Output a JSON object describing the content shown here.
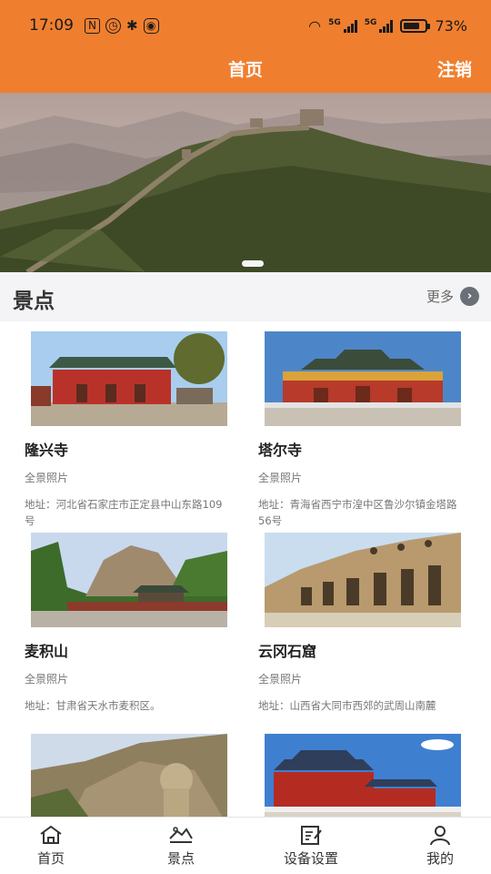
{
  "status_bar": {
    "time": "17:09",
    "battery": "73%",
    "network_1": "5G",
    "network_2": "5G",
    "icons": [
      "nfc-icon",
      "alarm-icon",
      "bluetooth-icon",
      "eye-icon",
      "wifi-icon",
      "signal-icon",
      "battery-icon"
    ]
  },
  "header": {
    "title": "首页",
    "logout": "注销"
  },
  "section": {
    "title": "景点",
    "more": "更多"
  },
  "attractions": [
    {
      "name": "隆兴寺",
      "tag": "全景照片",
      "address": "地址：河北省石家庄市正定县中山东路109号"
    },
    {
      "name": "塔尔寺",
      "tag": "全景照片",
      "address": "地址：青海省西宁市湟中区鲁沙尔镇金塔路56号"
    },
    {
      "name": "麦积山",
      "tag": "全景照片",
      "address": "地址：甘肃省天水市麦积区。"
    },
    {
      "name": "云冈石窟",
      "tag": "全景照片",
      "address": "地址：山西省大同市西郊的武周山南麓"
    }
  ],
  "bottom_nav": [
    {
      "label": "首页",
      "icon": "home-icon"
    },
    {
      "label": "景点",
      "icon": "scenery-icon"
    },
    {
      "label": "设备设置",
      "icon": "edit-icon"
    },
    {
      "label": "我的",
      "icon": "user-icon"
    }
  ],
  "colors": {
    "brand": "#ef7f2f",
    "section_bg": "#f4f4f6"
  }
}
